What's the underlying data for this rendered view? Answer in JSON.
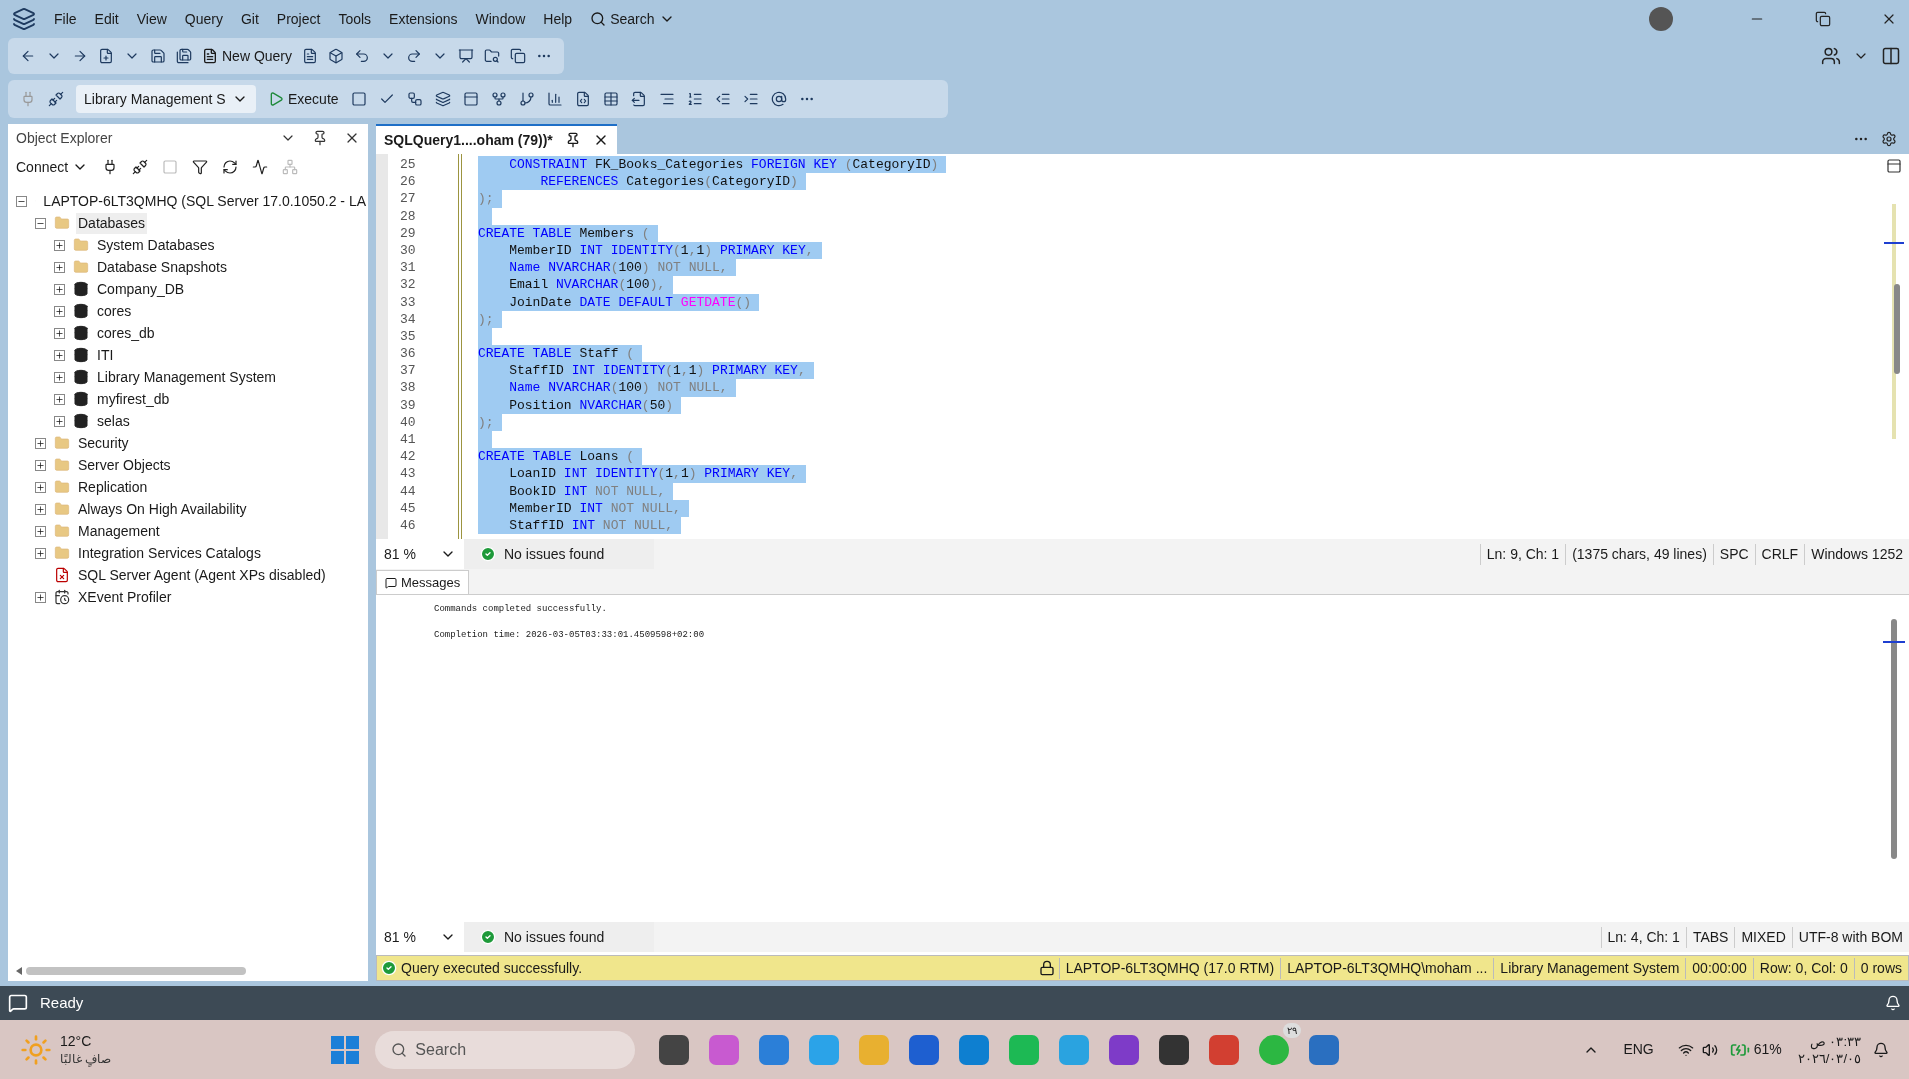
{
  "menu": {
    "items": [
      "File",
      "Edit",
      "View",
      "Query",
      "Git",
      "Project",
      "Tools",
      "Extensions",
      "Window",
      "Help"
    ],
    "search": "Search"
  },
  "toolbar": {
    "new_query": "New Query",
    "database": "Library Management S",
    "execute": "Execute"
  },
  "object_explorer": {
    "title": "Object Explorer",
    "connect": "Connect",
    "tree": [
      {
        "label": "LAPTOP-6LT3QMHQ (SQL Server 17.0.1050.2 - LA",
        "kind": "server",
        "expanded": true,
        "children": [
          {
            "label": "Databases",
            "kind": "folder",
            "expanded": true,
            "selected": true,
            "children": [
              {
                "label": "System Databases",
                "kind": "folder",
                "expanded": false
              },
              {
                "label": "Database Snapshots",
                "kind": "folder",
                "expanded": false
              },
              {
                "label": "Company_DB",
                "kind": "database",
                "expanded": false
              },
              {
                "label": "cores",
                "kind": "database",
                "expanded": false
              },
              {
                "label": "cores_db",
                "kind": "database",
                "expanded": false
              },
              {
                "label": "ITI",
                "kind": "database",
                "expanded": false
              },
              {
                "label": "Library Management System",
                "kind": "database",
                "expanded": false
              },
              {
                "label": "myfirest_db",
                "kind": "database",
                "expanded": false
              },
              {
                "label": "selas",
                "kind": "database",
                "expanded": false
              }
            ]
          },
          {
            "label": "Security",
            "kind": "folder",
            "expanded": false
          },
          {
            "label": "Server Objects",
            "kind": "folder",
            "expanded": false
          },
          {
            "label": "Replication",
            "kind": "folder",
            "expanded": false
          },
          {
            "label": "Always On High Availability",
            "kind": "folder",
            "expanded": false
          },
          {
            "label": "Management",
            "kind": "folder",
            "expanded": false
          },
          {
            "label": "Integration Services Catalogs",
            "kind": "folder",
            "expanded": false
          },
          {
            "label": "SQL Server Agent (Agent XPs disabled)",
            "kind": "agent"
          },
          {
            "label": "XEvent Profiler",
            "kind": "xevent",
            "expanded": false
          }
        ]
      }
    ]
  },
  "editor": {
    "tab": "SQLQuery1....oham (79))*",
    "lines": [
      {
        "number": "25",
        "tokens": [
          {
            "kind": "kw",
            "text": "    CONSTRAINT"
          },
          {
            "kind": "plain",
            "text": " FK_Books_Categories "
          },
          {
            "kind": "kw",
            "text": "FOREIGN KEY"
          },
          {
            "kind": "punct",
            "text": " ("
          },
          {
            "kind": "plain",
            "text": "CategoryID"
          },
          {
            "kind": "punct",
            "text": ")"
          }
        ]
      },
      {
        "number": "26",
        "tokens": [
          {
            "kind": "kw",
            "text": "        REFERENCES"
          },
          {
            "kind": "plain",
            "text": " Categories"
          },
          {
            "kind": "punct",
            "text": "("
          },
          {
            "kind": "plain",
            "text": "CategoryID"
          },
          {
            "kind": "punct",
            "text": ")"
          }
        ]
      },
      {
        "number": "27",
        "tokens": [
          {
            "kind": "punct",
            "text": ");"
          }
        ]
      },
      {
        "number": "28"
      },
      {
        "number": "29",
        "tokens": [
          {
            "kind": "kw",
            "text": "CREATE TABLE"
          },
          {
            "kind": "plain",
            "text": " Members "
          },
          {
            "kind": "punct",
            "text": "("
          }
        ]
      },
      {
        "number": "30",
        "tokens": [
          {
            "kind": "plain",
            "text": "    MemberID "
          },
          {
            "kind": "kw",
            "text": "INT IDENTITY"
          },
          {
            "kind": "punct",
            "text": "("
          },
          {
            "kind": "plain",
            "text": "1"
          },
          {
            "kind": "punct",
            "text": ","
          },
          {
            "kind": "plain",
            "text": "1"
          },
          {
            "kind": "punct",
            "text": ") "
          },
          {
            "kind": "kw",
            "text": "PRIMARY KEY"
          },
          {
            "kind": "punct",
            "text": ","
          }
        ]
      },
      {
        "number": "31",
        "tokens": [
          {
            "kind": "kw",
            "text": "    Name NVARCHAR"
          },
          {
            "kind": "punct",
            "text": "("
          },
          {
            "kind": "plain",
            "text": "100"
          },
          {
            "kind": "punct",
            "text": ") NOT NULL,"
          }
        ]
      },
      {
        "number": "32",
        "tokens": [
          {
            "kind": "plain",
            "text": "    Email "
          },
          {
            "kind": "kw",
            "text": "NVARCHAR"
          },
          {
            "kind": "punct",
            "text": "("
          },
          {
            "kind": "plain",
            "text": "100"
          },
          {
            "kind": "punct",
            "text": "),"
          }
        ]
      },
      {
        "number": "33",
        "tokens": [
          {
            "kind": "plain",
            "text": "    JoinDate "
          },
          {
            "kind": "kw",
            "text": "DATE DEFAULT "
          },
          {
            "kind": "func",
            "text": "GETDATE"
          },
          {
            "kind": "punct",
            "text": "()"
          }
        ]
      },
      {
        "number": "34",
        "tokens": [
          {
            "kind": "punct",
            "text": ");"
          }
        ]
      },
      {
        "number": "35"
      },
      {
        "number": "36",
        "tokens": [
          {
            "kind": "kw",
            "text": "CREATE TABLE"
          },
          {
            "kind": "plain",
            "text": " Staff "
          },
          {
            "kind": "punct",
            "text": "("
          }
        ]
      },
      {
        "number": "37",
        "tokens": [
          {
            "kind": "plain",
            "text": "    StaffID "
          },
          {
            "kind": "kw",
            "text": "INT IDENTITY"
          },
          {
            "kind": "punct",
            "text": "("
          },
          {
            "kind": "plain",
            "text": "1"
          },
          {
            "kind": "punct",
            "text": ","
          },
          {
            "kind": "plain",
            "text": "1"
          },
          {
            "kind": "punct",
            "text": ") "
          },
          {
            "kind": "kw",
            "text": "PRIMARY KEY"
          },
          {
            "kind": "punct",
            "text": ","
          }
        ]
      },
      {
        "number": "38",
        "tokens": [
          {
            "kind": "kw",
            "text": "    Name NVARCHAR"
          },
          {
            "kind": "punct",
            "text": "("
          },
          {
            "kind": "plain",
            "text": "100"
          },
          {
            "kind": "punct",
            "text": ") NOT NULL,"
          }
        ]
      },
      {
        "number": "39",
        "tokens": [
          {
            "kind": "plain",
            "text": "    Position "
          },
          {
            "kind": "kw",
            "text": "NVARCHAR"
          },
          {
            "kind": "punct",
            "text": "("
          },
          {
            "kind": "plain",
            "text": "50"
          },
          {
            "kind": "punct",
            "text": ")"
          }
        ]
      },
      {
        "number": "40",
        "tokens": [
          {
            "kind": "punct",
            "text": ");"
          }
        ]
      },
      {
        "number": "41"
      },
      {
        "number": "42",
        "tokens": [
          {
            "kind": "kw",
            "text": "CREATE TABLE"
          },
          {
            "kind": "plain",
            "text": " Loans "
          },
          {
            "kind": "punct",
            "text": "("
          }
        ]
      },
      {
        "number": "43",
        "tokens": [
          {
            "kind": "plain",
            "text": "    LoanID "
          },
          {
            "kind": "kw",
            "text": "INT IDENTITY"
          },
          {
            "kind": "punct",
            "text": "("
          },
          {
            "kind": "plain",
            "text": "1"
          },
          {
            "kind": "punct",
            "text": ","
          },
          {
            "kind": "plain",
            "text": "1"
          },
          {
            "kind": "punct",
            "text": ") "
          },
          {
            "kind": "kw",
            "text": "PRIMARY KEY"
          },
          {
            "kind": "punct",
            "text": ","
          }
        ]
      },
      {
        "number": "44",
        "tokens": [
          {
            "kind": "plain",
            "text": "    BookID "
          },
          {
            "kind": "kw",
            "text": "INT"
          },
          {
            "kind": "punct",
            "text": " NOT NULL,"
          }
        ]
      },
      {
        "number": "45",
        "tokens": [
          {
            "kind": "plain",
            "text": "    MemberID "
          },
          {
            "kind": "kw",
            "text": "INT"
          },
          {
            "kind": "punct",
            "text": " NOT NULL,"
          }
        ]
      },
      {
        "number": "46",
        "tokens": [
          {
            "kind": "plain",
            "text": "    StaffID "
          },
          {
            "kind": "kw",
            "text": "INT"
          },
          {
            "kind": "punct",
            "text": " NOT NULL,"
          }
        ]
      }
    ],
    "status": {
      "zoom": "81 %",
      "issues": "No issues found",
      "items": [
        "Ln: 9, Ch: 1",
        "(1375 chars, 49 lines)",
        "SPC",
        "CRLF",
        "Windows 1252"
      ]
    }
  },
  "messages": {
    "tab": "Messages",
    "lines": [
      "Commands completed successfully.",
      "Completion time: 2026-03-05T03:33:01.4509598+02:00"
    ],
    "status": {
      "zoom": "81 %",
      "issues": "No issues found",
      "items": [
        "Ln: 4, Ch: 1",
        "TABS",
        "MIXED",
        "UTF-8 with BOM"
      ]
    }
  },
  "query_status": {
    "message": "Query executed successfully.",
    "items": [
      "LAPTOP-6LT3QMHQ (17.0 RTM)",
      "LAPTOP-6LT3QMHQ\\moham ...",
      "Library Management System",
      "00:00:00",
      "Row: 0, Col: 0",
      "0 rows"
    ]
  },
  "status_bar": "Ready",
  "taskbar": {
    "temperature": "12°C",
    "weather": "صافٍ غالبًا",
    "search": "Search",
    "badge": "٢٩",
    "language": "ENG",
    "battery": "61%",
    "time": "٠٣:٣٣ ص",
    "date": "٢٠٢٦/٠٣/٠٥"
  }
}
